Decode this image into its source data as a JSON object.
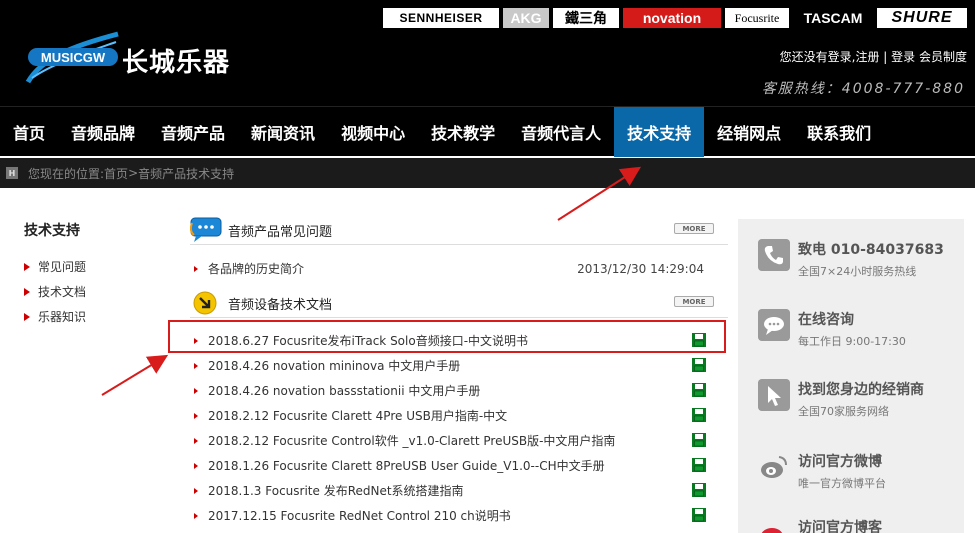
{
  "header": {
    "logo_badge": "MUSICGW",
    "logo_text": "长城乐器",
    "brands": [
      "SENNHEISER",
      "AKG",
      "鐵三角",
      "novation",
      "Focusrite",
      "TASCAM",
      "SHURE"
    ],
    "user_links": {
      "not_logged": "您还没有登录,",
      "register": "注册",
      "sep": " | ",
      "login": "登录",
      "membership": " 会员制度"
    },
    "hotline": "客服热线：4008-777-880"
  },
  "nav": {
    "items": [
      "首页",
      "音频品牌",
      "音频产品",
      "新闻资讯",
      "视频中心",
      "技术教学",
      "音频代言人",
      "技术支持",
      "经销网点",
      "联系我们"
    ],
    "active_index": 7
  },
  "breadcrumb": {
    "icon": "H",
    "prefix": "您现在的位置: ",
    "home": "首页",
    "sep": " > ",
    "current": "音频产品技术支持"
  },
  "sidebar": {
    "title": "技术支持",
    "items": [
      "常见问题",
      "技术文档",
      "乐器知识"
    ]
  },
  "faq": {
    "title": "音频产品常见问题",
    "more": "MORE",
    "items": [
      {
        "text": "各品牌的历史简介",
        "date": "2013/12/30 14:29:04"
      }
    ]
  },
  "docs": {
    "title": "音频设备技术文档",
    "more": "MORE",
    "items": [
      "2018.6.27 Focusrite发布iTrack Solo音频接口-中文说明书",
      "2018.4.26 novation mininova 中文用户手册",
      "2018.4.26 novation bassstationii 中文用户手册",
      "2018.2.12 Focusrite Clarett 4Pre USB用户指南-中文",
      "2018.2.12 Focusrite Control软件 _v1.0-Clarett PreUSB版-中文用户指南",
      "2018.1.26 Focusrite Clarett 8PreUSB User Guide_V1.0--CH中文手册",
      "2018.1.3 Focusrite 发布RedNet系统搭建指南",
      "2017.12.15 Focusrite RedNet Control 210 ch说明书"
    ]
  },
  "right_panel": {
    "items": [
      {
        "icon": "phone-icon",
        "title": "致电  010-84037683",
        "sub": "全国7×24小时服务热线"
      },
      {
        "icon": "chat-icon",
        "title": "在线咨询",
        "sub": "每工作日 9:00-17:30"
      },
      {
        "icon": "cursor-icon",
        "title": "找到您身边的经销商",
        "sub": "全国70家服务网络"
      },
      {
        "icon": "weibo-icon",
        "title": "访问官方微博",
        "sub": "唯一官方微博平台"
      },
      {
        "icon": "blog-icon",
        "title": "访问官方博客",
        "sub": ""
      }
    ]
  },
  "colors": {
    "nav_active": "#0a67a8",
    "annotation_red": "#d81b1b",
    "novation_red": "#d51a1a",
    "bullet_red": "#cc0000"
  }
}
